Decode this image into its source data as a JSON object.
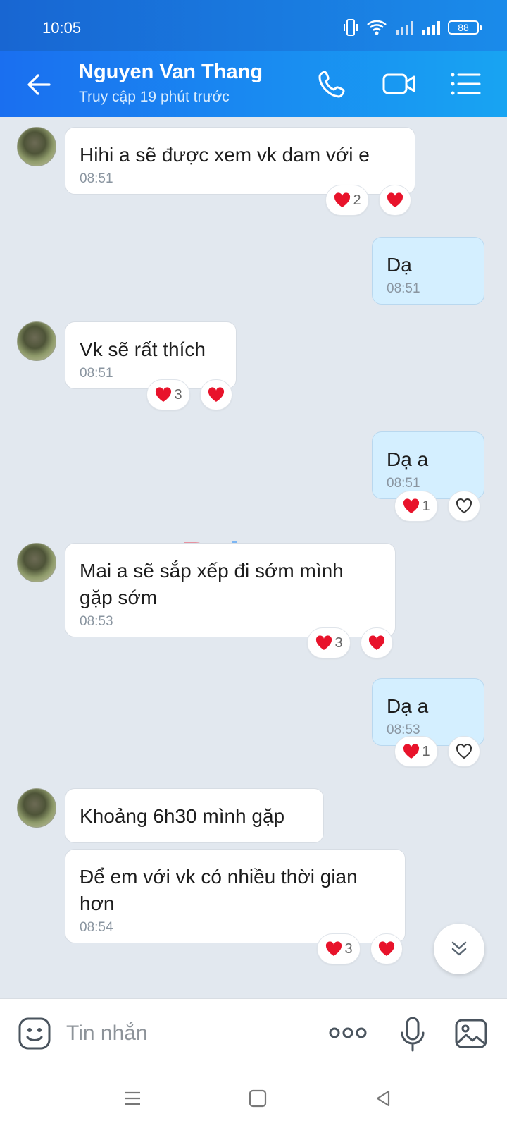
{
  "status_bar": {
    "time": "10:05",
    "battery": "88"
  },
  "header": {
    "contact_name": "Nguyen Van Thang",
    "last_seen": "Truy cập 19 phút trước"
  },
  "messages": [
    {
      "sender": "other",
      "text": "Hihi a sẽ được xem vk dam với e",
      "time": "08:51",
      "reaction_count": "2"
    },
    {
      "sender": "me",
      "text": "Dạ",
      "time": "08:51"
    },
    {
      "sender": "other",
      "text": "Vk sẽ rất thích",
      "time": "08:51",
      "reaction_count": "3"
    },
    {
      "sender": "me",
      "text": "Dạ a",
      "time": "08:51",
      "reaction_count": "1"
    },
    {
      "sender": "other",
      "text": "Mai a sẽ sắp xếp đi sớm mình gặp sớm",
      "time": "08:53",
      "reaction_count": "3"
    },
    {
      "sender": "me",
      "text": "Dạ a",
      "time": "08:53",
      "reaction_count": "1"
    },
    {
      "sender": "other",
      "text": "Khoảng 6h30 mình gặp",
      "time": ""
    },
    {
      "sender": "other",
      "text": "Để em với vk có nhiều thời gian hơn",
      "time": "08:54",
      "reaction_count": "3"
    }
  ],
  "watermark": {
    "first": "R",
    "rest": "phang"
  },
  "input": {
    "placeholder": "Tin nhắn"
  },
  "icons": {
    "back": "arrow-left-icon",
    "call": "phone-icon",
    "video": "video-camera-icon",
    "menu": "list-menu-icon",
    "emoji": "sticker-icon",
    "more": "more-dots-icon",
    "mic": "microphone-icon",
    "image": "image-icon",
    "heart": "heart-icon",
    "scroll": "double-chevron-down-icon"
  },
  "colors": {
    "header_start": "#1a6ff0",
    "header_end": "#18a4f2",
    "my_bubble": "#d4efff",
    "heart": "#e8132b"
  }
}
